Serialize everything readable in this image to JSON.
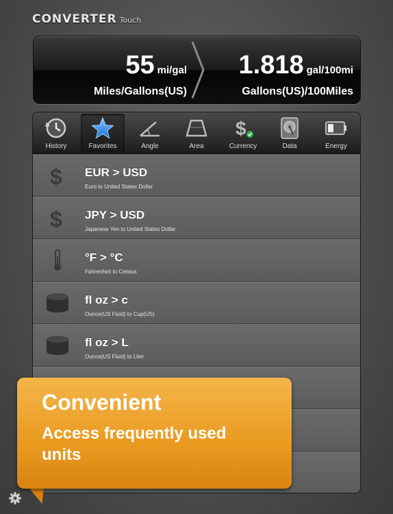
{
  "app": {
    "title": "CONVERTER",
    "subtitle": "Touch"
  },
  "display": {
    "left": {
      "value": "55",
      "unit": "mi/gal",
      "name": "Miles/Gallons(US)"
    },
    "right": {
      "value": "1.818",
      "unit": "gal/100mi",
      "name": "Gallons(US)/100Miles"
    }
  },
  "tabs": [
    {
      "label": "History",
      "icon": "history-icon"
    },
    {
      "label": "Favorites",
      "icon": "star-icon",
      "active": true
    },
    {
      "label": "Angle",
      "icon": "angle-icon"
    },
    {
      "label": "Area",
      "icon": "area-icon"
    },
    {
      "label": "Currency",
      "icon": "currency-icon"
    },
    {
      "label": "Data",
      "icon": "hard-drive-icon"
    },
    {
      "label": "Energy",
      "icon": "battery-icon"
    }
  ],
  "favorites": [
    {
      "code": "EUR > USD",
      "desc": "Euro to United States Dollar",
      "icon": "dollar-icon"
    },
    {
      "code": "JPY > USD",
      "desc": "Japanese Yen to United States Dollar",
      "icon": "dollar-icon"
    },
    {
      "code": "°F > °C",
      "desc": "Fahrenheit to Celsius",
      "icon": "thermometer-icon"
    },
    {
      "code": "fl oz > c",
      "desc": "Ounce(US Fluid) to Cup(US)",
      "icon": "cylinder-icon"
    },
    {
      "code": "fl oz > L",
      "desc": "Ounce(US Fluid) to Liter",
      "icon": "cylinder-icon"
    }
  ],
  "callout": {
    "headline": "Convenient",
    "body": "Access frequently used units"
  }
}
